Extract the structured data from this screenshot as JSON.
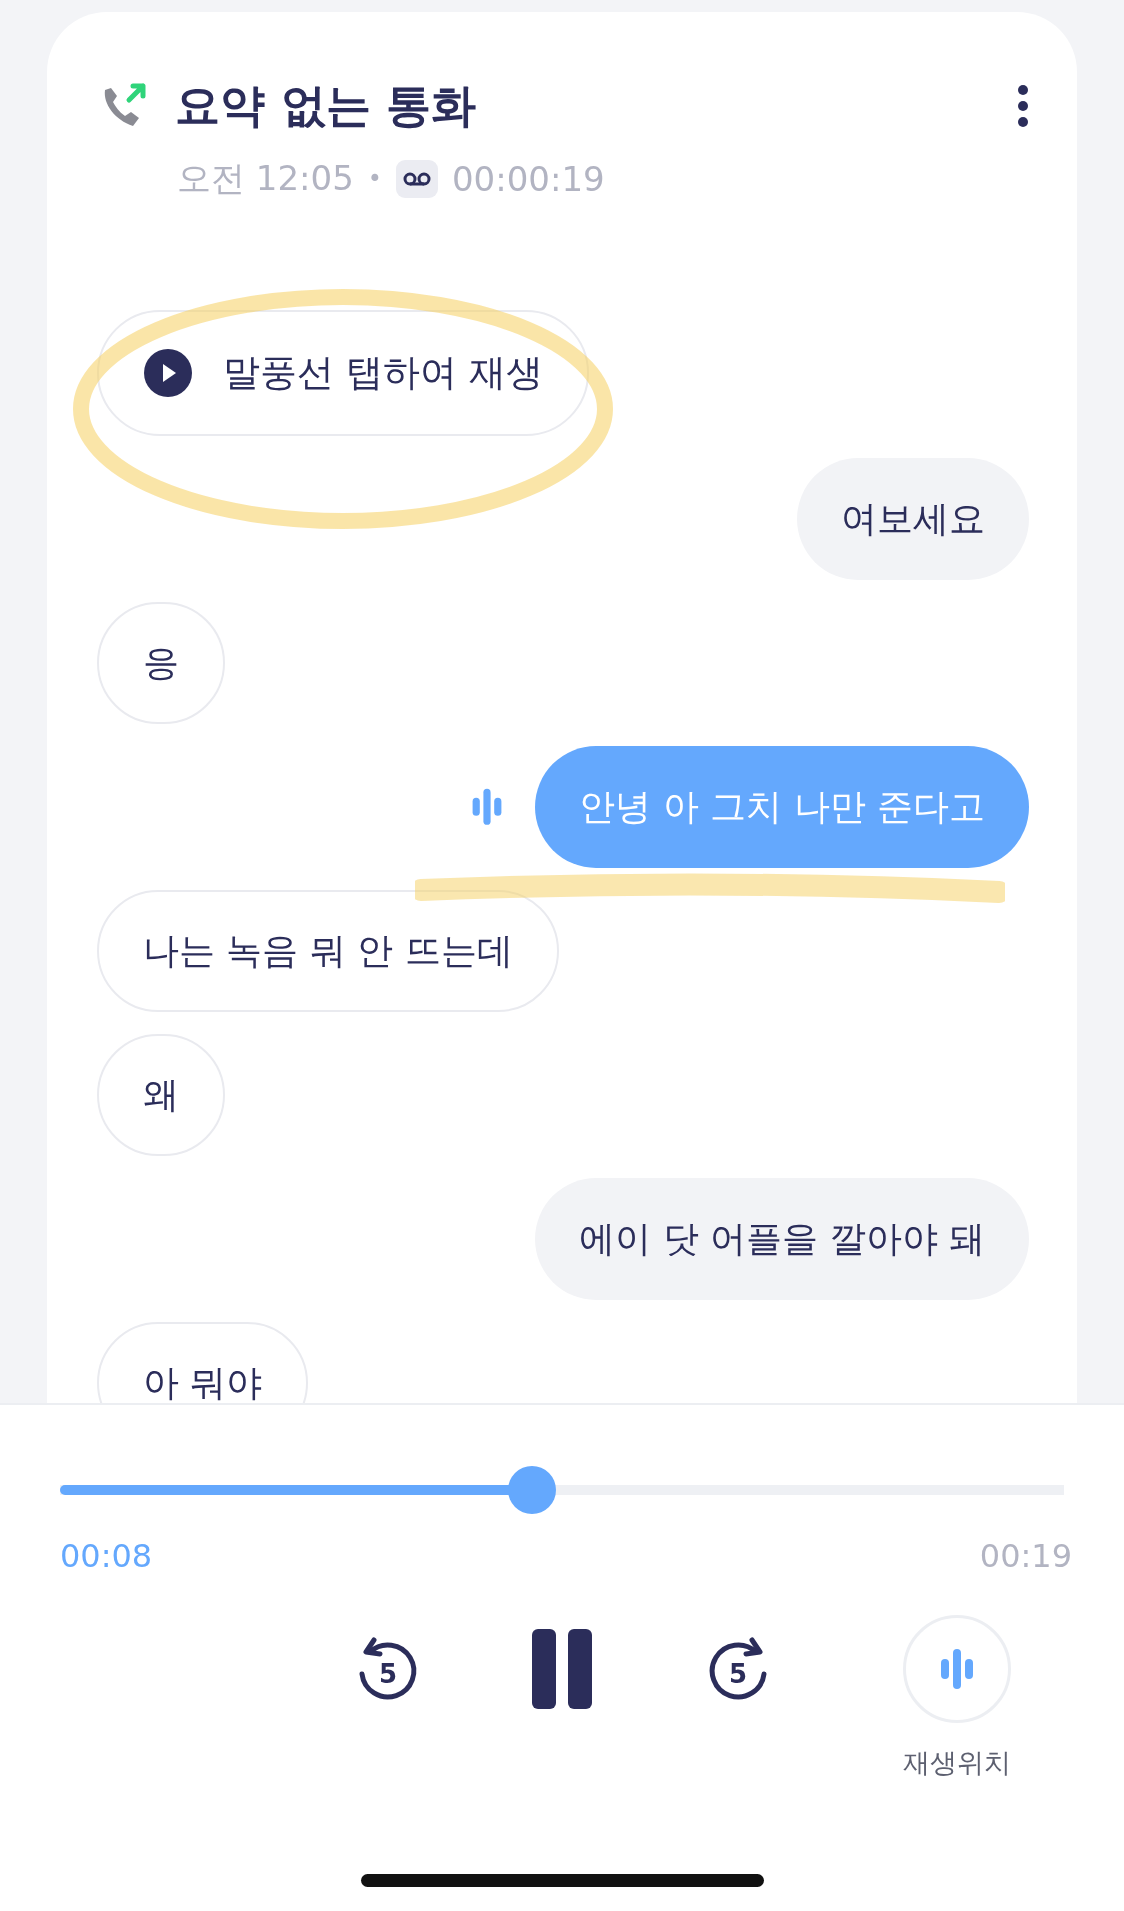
{
  "header": {
    "title": "요약 없는 통화",
    "time": "오전 12:05",
    "separator": "•",
    "duration": "00:00:19"
  },
  "play_hint": {
    "label": "말풍선 탭하여 재생"
  },
  "messages": [
    {
      "text": "여보세요",
      "kind": "sent",
      "playing": false
    },
    {
      "text": "응",
      "kind": "received",
      "playing": false
    },
    {
      "text": "안녕 아 그치 나만 준다고",
      "kind": "sent",
      "playing": true
    },
    {
      "text": "나는 녹음 뭐 안 뜨는데",
      "kind": "received",
      "playing": false
    },
    {
      "text": "왜",
      "kind": "received",
      "playing": false
    },
    {
      "text": "에이 닷 어플을 깔아야 돼",
      "kind": "sent",
      "playing": false
    },
    {
      "text": "아 뭐야",
      "kind": "received",
      "playing": false
    }
  ],
  "player": {
    "level": 0.47,
    "current": "00:08",
    "total": "00:19",
    "replay_step": "5",
    "forward_step": "5",
    "position_label": "재생위치"
  }
}
